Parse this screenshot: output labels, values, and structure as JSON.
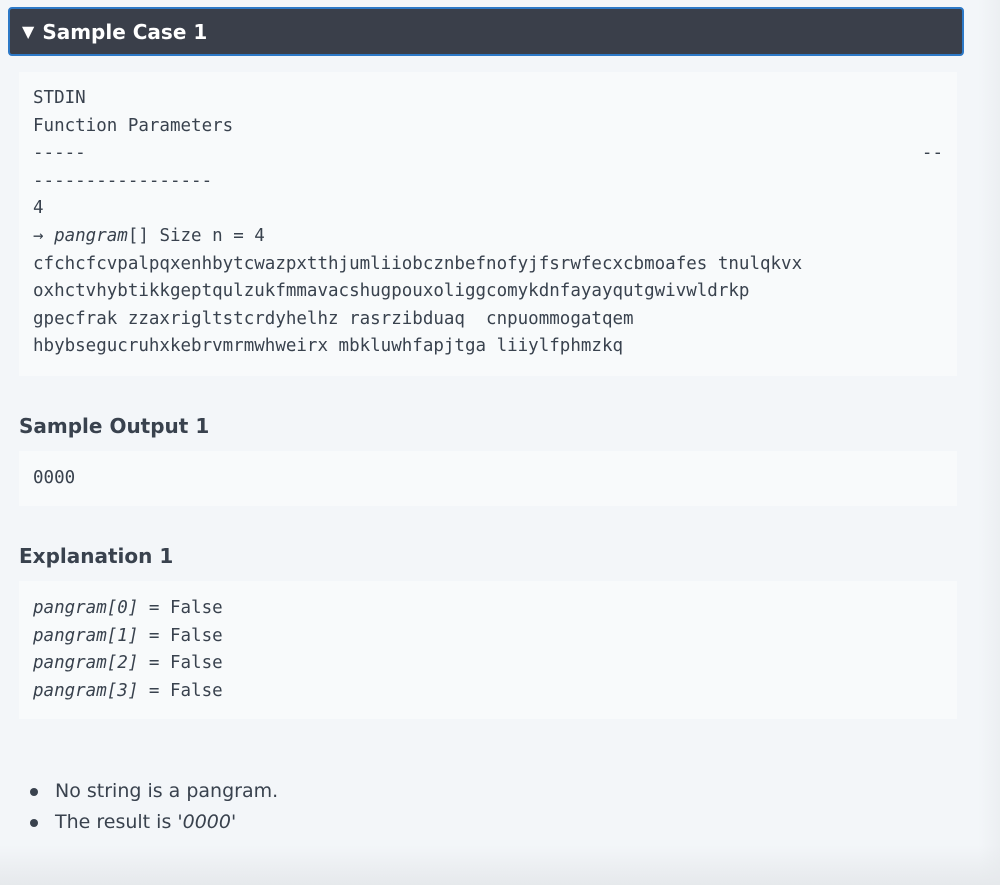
{
  "sample_case": {
    "caret": "▼",
    "title": "Sample Case 1"
  },
  "stdin_block": {
    "line_stdin": "STDIN",
    "line_params": "Function Parameters",
    "sep_left": "-----",
    "sep_right": "--",
    "sep_wrap": "-----------------",
    "count": "4",
    "arrow": "→ ",
    "param_name": "pangram",
    "param_rest": "[] Size n = 4",
    "strings": [
      "cfchcfcvpalpqxenhbytcwazpxtthjumliiobcznbefnofyjfsrwfecxcbmoafes tnulqkvx",
      "oxhctvhybtikkgeptqulzukfmmavacshugpouxoliggcomykdnfayayqutgwivwldrkp",
      "gpecfrak zzaxrigltstcrdyhelhz rasrzibduaq  cnpuommogatqem",
      "hbybsegucruhxkebrvmrmwhweirx mbkluwhfapjtga liiylfphmzkq"
    ]
  },
  "sample_output": {
    "heading": "Sample Output 1",
    "value": "0000"
  },
  "explanation": {
    "heading": "Explanation 1",
    "rows": [
      {
        "expr": "pangram[0]",
        "rest": " = False"
      },
      {
        "expr": "pangram[1]",
        "rest": " = False"
      },
      {
        "expr": "pangram[2]",
        "rest": " = False"
      },
      {
        "expr": "pangram[3]",
        "rest": " = False"
      }
    ],
    "bullets": {
      "b1": "No string is a pangram.",
      "b2_prefix": "The result is ",
      "b2_value": "'0000'"
    }
  }
}
